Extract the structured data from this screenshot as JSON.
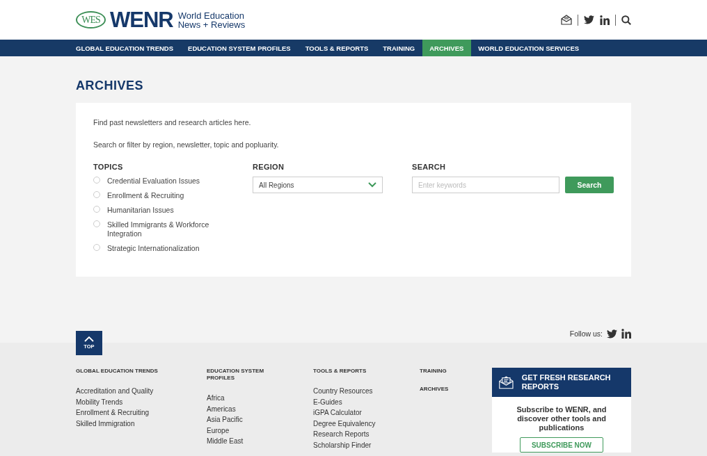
{
  "header": {
    "logo_badge": "WES",
    "logo_wordmark": "WENR",
    "tagline_line_1": "World Education",
    "tagline_line_2": "News + Reviews"
  },
  "nav": [
    {
      "label": "GLOBAL EDUCATION TRENDS",
      "selected": false
    },
    {
      "label": "EDUCATION SYSTEM PROFILES",
      "selected": false
    },
    {
      "label": "TOOLS & REPORTS",
      "selected": false
    },
    {
      "label": "TRAINING",
      "selected": false
    },
    {
      "label": "ARCHIVES",
      "selected": true
    },
    {
      "label": "WORLD EDUCATION SERVICES",
      "selected": false
    }
  ],
  "page_title": "ARCHIVES",
  "intro": [
    "Find past newsletters and research articles here.",
    "Search or filter by region, newsletter, topic and popluarity."
  ],
  "topics": {
    "heading": "TOPICS",
    "items": [
      {
        "label": "Credential Evaluation Issues",
        "checked": false
      },
      {
        "label": "Enrollment & Recruiting",
        "checked": false
      },
      {
        "label": "Humanitarian Issues",
        "checked": false
      },
      {
        "label": "Skilled Immigrants & Workforce Integration",
        "checked": false
      },
      {
        "label": "Strategic Internationalization",
        "checked": false
      }
    ]
  },
  "region": {
    "heading": "REGION",
    "value": "All Regions"
  },
  "search": {
    "heading": "SEARCH",
    "placeholder": "Enter keywords",
    "button": "Search"
  },
  "footer": {
    "top_button": "TOP",
    "follow_label": "Follow us:",
    "columns": [
      {
        "headings": [
          "GLOBAL EDUCATION TRENDS"
        ],
        "links": [
          "Accreditation and Quality",
          "Mobility Trends",
          "Enrollment & Recruiting",
          "Skilled Immigration"
        ]
      },
      {
        "headings": [
          "EDUCATION SYSTEM PROFILES"
        ],
        "links": [
          "Africa",
          "Americas",
          "Asia Pacific",
          "Europe",
          "Middle East"
        ]
      },
      {
        "headings": [
          "TOOLS & REPORTS"
        ],
        "links": [
          "Country Resources",
          "E-Guides",
          "iGPA Calculator",
          "Degree Equivalency",
          "Research Reports",
          "Scholarship Finder"
        ]
      },
      {
        "headings": [
          "TRAINING",
          "ARCHIVES"
        ]
      }
    ],
    "subscribe": {
      "heading": "GET FRESH RESEARCH REPORTS",
      "text": "Subscribe to WENR, and discover other tools and publications",
      "button": "SUBSCRIBE NOW"
    }
  }
}
